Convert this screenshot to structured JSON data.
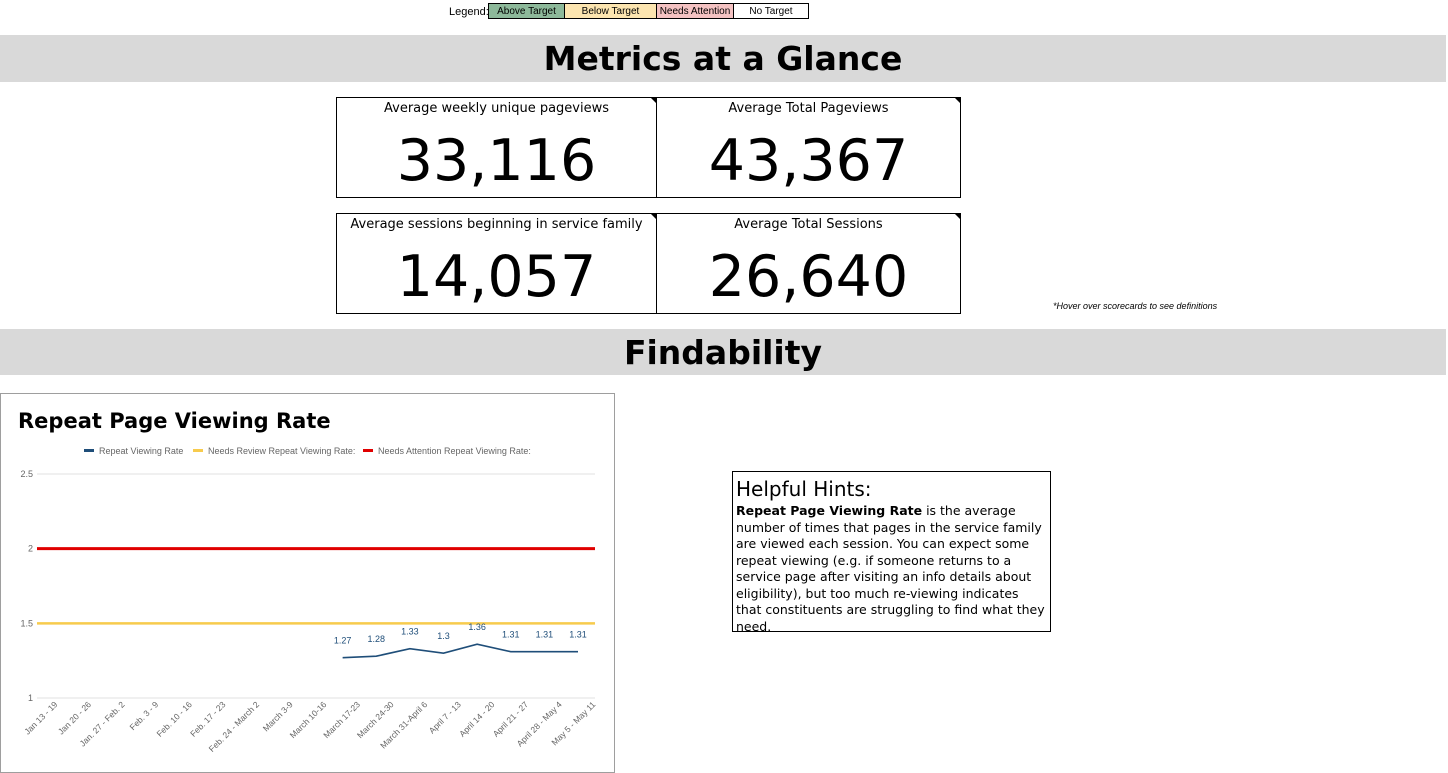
{
  "legend": {
    "label": "Legend:",
    "items": [
      {
        "label": "Above Target",
        "color": "#8db99a"
      },
      {
        "label": "Below Target",
        "color": "#fce5b0"
      },
      {
        "label": "Needs Attention",
        "color": "#f4c2c2"
      },
      {
        "label": "No Target",
        "color": "#ffffff"
      }
    ]
  },
  "sections": {
    "metrics_title": "Metrics at a Glance",
    "findability_title": "Findability"
  },
  "scorecards": [
    {
      "title": "Average weekly unique pageviews",
      "value": "33,116"
    },
    {
      "title": "Average Total Pageviews",
      "value": "43,367"
    },
    {
      "title": "Average sessions beginning in service family",
      "value": "14,057"
    },
    {
      "title": "Average Total Sessions",
      "value": "26,640"
    }
  ],
  "hover_note": "*Hover over scorecards to see definitions",
  "chart_data": {
    "type": "line",
    "title": "Repeat Page Viewing Rate",
    "categories": [
      "Jan 13 - 19",
      "Jan 20 - 26",
      "Jan. 27 - Feb. 2",
      "Feb. 3 - 9",
      "Feb. 10 - 16",
      "Feb. 17 - 23",
      "Feb. 24 - March 2",
      "March 3-9",
      "March 10-16",
      "March 17-23",
      "March 24-30",
      "March 31-April 6",
      "April 7 - 13",
      "April 14 - 20",
      "April 21 - 27",
      "April 28 - May 4",
      "May 5 - May 11"
    ],
    "series": [
      {
        "name": "Repeat Viewing Rate",
        "color": "#1f4e79",
        "values": [
          null,
          null,
          null,
          null,
          null,
          null,
          null,
          null,
          null,
          1.27,
          1.28,
          1.33,
          1.3,
          1.36,
          1.31,
          1.31,
          1.31
        ]
      },
      {
        "name": "Needs Review Repeat Viewing Rate:",
        "color": "#f7cb4d",
        "constant": 1.5
      },
      {
        "name": "Needs Attention Repeat Viewing Rate:",
        "color": "#e00000",
        "constant": 2
      }
    ],
    "ylim": [
      1,
      2.5
    ],
    "yticks": [
      "1",
      "1.5",
      "2",
      "2.5"
    ],
    "grid": true,
    "legend_position": "top"
  },
  "hints": {
    "title": "Helpful Hints:",
    "term": "Repeat Page Viewing Rate",
    "body": " is the average number of times that pages in the service family are viewed each session. You can expect some repeat viewing (e.g. if someone returns to a service page after visiting an info details about eligibility), but too much re-viewing indicates that constituents are struggling to find what they need."
  }
}
